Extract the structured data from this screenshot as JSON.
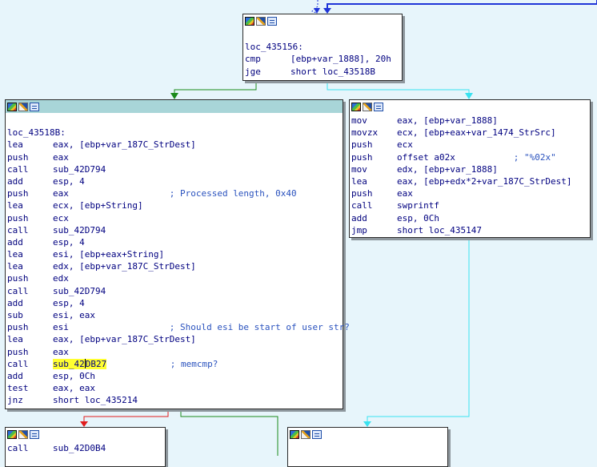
{
  "colors": {
    "background": "#e7f5fb",
    "edge_true": "#1b8a1b",
    "edge_false": "#e11d1d",
    "edge_unconditional": "#1f35d8",
    "edge_cyan": "#39e2f0",
    "highlight": "#ffff30",
    "selected_header": "#a8d5d8"
  },
  "header_icons": [
    "color-icon",
    "rename-icon",
    "graph-overview-icon"
  ],
  "blocks": {
    "loc_435156": {
      "lines": [
        {
          "blank": true
        },
        {
          "label": "loc_435156:"
        },
        {
          "mnemonic": "cmp",
          "operand": "[ebp+var_1888], 20h"
        },
        {
          "mnemonic": "jge",
          "operand": "short loc_43518B"
        }
      ]
    },
    "loc_43518B": {
      "lines": [
        {
          "blank": true
        },
        {
          "label": "loc_43518B:"
        },
        {
          "mnemonic": "lea",
          "operand": "eax, [ebp+var_187C_StrDest]"
        },
        {
          "mnemonic": "push",
          "operand": "eax"
        },
        {
          "mnemonic": "call",
          "operand": "sub_42D794"
        },
        {
          "mnemonic": "add",
          "operand": "esp, 4"
        },
        {
          "mnemonic": "push",
          "operand": "eax",
          "comment": "; Processed length, 0x40"
        },
        {
          "mnemonic": "lea",
          "operand": "ecx, [ebp+String]"
        },
        {
          "mnemonic": "push",
          "operand": "ecx"
        },
        {
          "mnemonic": "call",
          "operand": "sub_42D794"
        },
        {
          "mnemonic": "add",
          "operand": "esp, 4"
        },
        {
          "mnemonic": "lea",
          "operand": "esi, [ebp+eax+String]"
        },
        {
          "mnemonic": "lea",
          "operand": "edx, [ebp+var_187C_StrDest]"
        },
        {
          "mnemonic": "push",
          "operand": "edx"
        },
        {
          "mnemonic": "call",
          "operand": "sub_42D794"
        },
        {
          "mnemonic": "add",
          "operand": "esp, 4"
        },
        {
          "mnemonic": "sub",
          "operand": "esi, eax"
        },
        {
          "mnemonic": "push",
          "operand": "esi",
          "comment": "; Should esi be start of user str?"
        },
        {
          "mnemonic": "lea",
          "operand": "eax, [ebp+var_187C_StrDest]"
        },
        {
          "mnemonic": "push",
          "operand": "eax"
        },
        {
          "mnemonic": "call",
          "operand_hl_a": "sub_42",
          "operand_hl_b": "DB27",
          "comment": "; memcmp?"
        },
        {
          "mnemonic": "add",
          "operand": "esp, 0Ch"
        },
        {
          "mnemonic": "test",
          "operand": "eax, eax"
        },
        {
          "mnemonic": "jnz",
          "operand": "short loc_435214"
        }
      ]
    },
    "loop_body": {
      "lines": [
        {
          "mnemonic": "mov",
          "operand": "eax, [ebp+var_1888]"
        },
        {
          "mnemonic": "movzx",
          "operand": "ecx, [ebp+eax+var_1474_StrSrc]"
        },
        {
          "mnemonic": "push",
          "operand": "ecx"
        },
        {
          "mnemonic": "push",
          "operand": "offset a02x",
          "comment": "; \"%02x\""
        },
        {
          "mnemonic": "mov",
          "operand": "edx, [ebp+var_1888]"
        },
        {
          "mnemonic": "lea",
          "operand": "eax, [ebp+edx*2+var_187C_StrDest]"
        },
        {
          "mnemonic": "push",
          "operand": "eax"
        },
        {
          "mnemonic": "call",
          "operand": "swprintf"
        },
        {
          "mnemonic": "add",
          "operand": "esp, 0Ch"
        },
        {
          "mnemonic": "jmp",
          "operand": "short loc_435147"
        }
      ]
    },
    "fail_block": {
      "lines": [
        {
          "mnemonic": "call",
          "operand": "sub_42D0B4"
        }
      ]
    },
    "success_block": {
      "lines": []
    }
  }
}
